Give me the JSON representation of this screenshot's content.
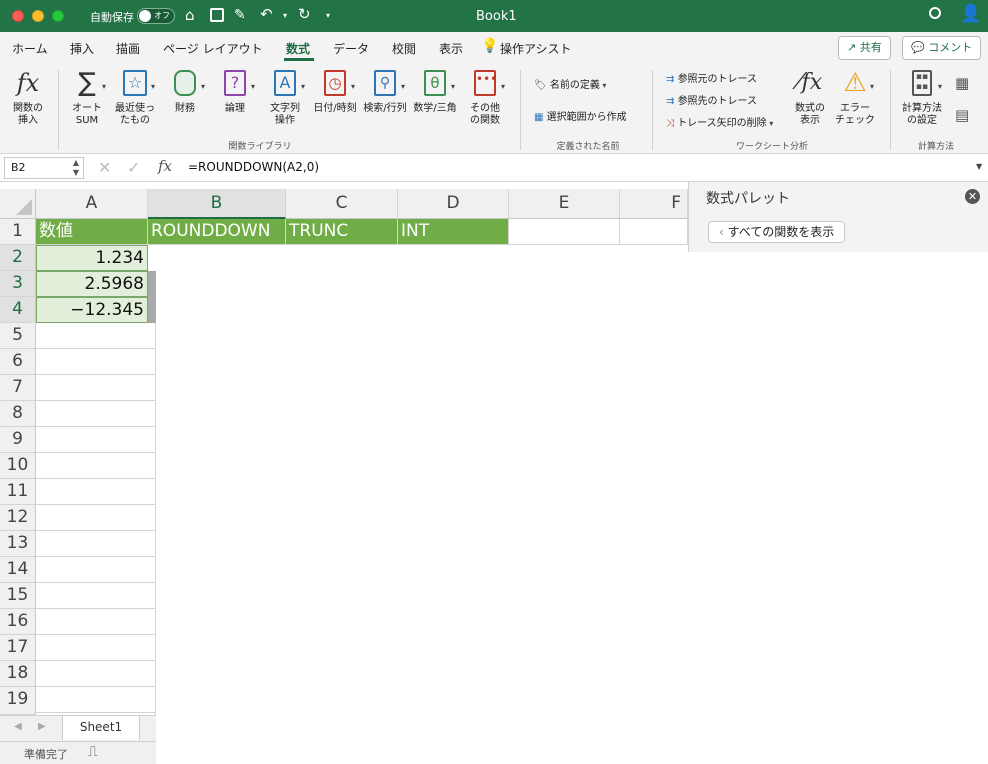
{
  "titlebar": {
    "autosave_label": "自動保存",
    "autosave_state": "オフ",
    "document_title": "Book1"
  },
  "menu": {
    "tabs": [
      "ホーム",
      "挿入",
      "描画",
      "ページ レイアウト",
      "数式",
      "データ",
      "校閲",
      "表示",
      "操作アシスト"
    ],
    "active_tab": "数式",
    "share_label": "共有",
    "comment_label": "コメント"
  },
  "ribbon": {
    "insert_function": "関数の\n挿入",
    "autosum": "オート\nSUM",
    "recent": "最近使っ\nたもの",
    "financial": "財務",
    "logical": "論理",
    "text": "文字列\n操作",
    "datetime": "日付/時刻",
    "lookup": "検索/行列",
    "math": "数学/三角",
    "more": "その他\nの関数",
    "define_name": "名前の定義",
    "create_from_selection": "選択範囲から作成",
    "trace_precedents": "参照元のトレース",
    "trace_dependents": "参照先のトレース",
    "remove_arrows": "トレース矢印の削除",
    "show_formulas": "数式の\n表示",
    "error_checking": "エラー\nチェック",
    "calc_options": "計算方法\nの設定",
    "group_function_library": "関数ライブラリ",
    "group_defined_names": "定義された名前",
    "group_formula_auditing": "ワークシート分析",
    "group_calculation": "計算方法"
  },
  "formula_bar": {
    "name_box": "B2",
    "fx": "fx",
    "formula": "=ROUNDDOWN(A2,0)"
  },
  "grid": {
    "columns": [
      "A",
      "B",
      "C",
      "D",
      "E",
      "F"
    ],
    "selected_column": "B",
    "rows": [
      "1",
      "2",
      "3",
      "4",
      "5",
      "6",
      "7",
      "8",
      "9",
      "10",
      "11",
      "12",
      "13",
      "14",
      "15",
      "16",
      "17",
      "18",
      "19"
    ],
    "header_row": [
      "数値",
      "ROUNDDOWN",
      "TRUNC",
      "INT"
    ],
    "values": [
      "1.234",
      "2.5968",
      "−12.345"
    ]
  },
  "sheets": {
    "tabs": [
      "Sheet1"
    ]
  },
  "status": {
    "text": "準備完了"
  },
  "pane": {
    "title": "数式パレット",
    "show_all_functions": "すべての関数を表示"
  },
  "colors": {
    "excel_green": "#227447",
    "header_fill": "#70ad47",
    "value_fill": "#e2efda"
  }
}
